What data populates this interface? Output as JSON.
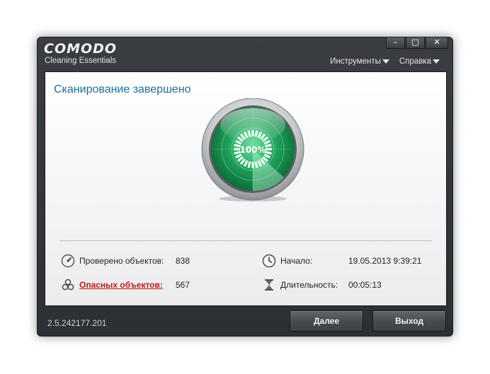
{
  "app": {
    "logo": "COMODO",
    "subtitle": "Cleaning Essentials",
    "version": "2.5.242177.201"
  },
  "window_controls": {
    "minimize": "–",
    "maximize": "□",
    "close": "✕"
  },
  "menu": {
    "tools": "Инструменты",
    "help": "Справка"
  },
  "scan": {
    "title": "Сканирование завершено",
    "progress_text": "100%",
    "progress": 1.0
  },
  "stats": {
    "checked_label": "Проверено объектов:",
    "checked_value": "838",
    "danger_label": "Опасных объектов:",
    "danger_value": "567",
    "start_label": "Начало:",
    "start_value": "19.05.2013 9:39:21",
    "duration_label": "Длительность:",
    "duration_value": "00:05:13"
  },
  "buttons": {
    "next": "Далее",
    "exit": "Выход"
  },
  "colors": {
    "title": "#1e6e99",
    "danger": "#c01818",
    "radar_green": "#1fa05a"
  },
  "icons": {
    "checked": "gauge-icon",
    "danger": "biohazard-icon",
    "start": "clock-icon",
    "duration": "hourglass-icon"
  }
}
